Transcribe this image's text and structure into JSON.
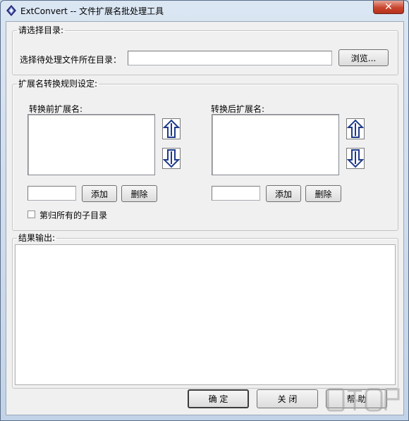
{
  "window": {
    "title": "ExtConvert -- 文件扩展名批处理工具",
    "close_label": "✕"
  },
  "directory_group": {
    "legend": "请选择目录:",
    "label": "选择待处理文件所在目录：",
    "path_value": "",
    "browse_label": "浏览..."
  },
  "rules_group": {
    "legend": "扩展名转换规则设定:",
    "before": {
      "label": "转换前扩展名:",
      "items": [],
      "input_value": "",
      "add_label": "添加",
      "delete_label": "删除"
    },
    "after": {
      "label": "转换后扩展名:",
      "items": [],
      "input_value": "",
      "add_label": "添加",
      "delete_label": "删除"
    },
    "recursive_label": "第归所有的子目录",
    "recursive_checked": false
  },
  "output_group": {
    "legend": "结果输出:",
    "content": ""
  },
  "buttons": {
    "ok_label": "确 定",
    "close_label": "关 闭",
    "help_label": "帮 助"
  },
  "colors": {
    "arrow_blue": "#1f3a8a",
    "title_bar": "#c3d3e7"
  },
  "icons": {
    "app": "diamond-app-icon",
    "up": "arrow-up-icon",
    "down": "arrow-down-icon"
  }
}
